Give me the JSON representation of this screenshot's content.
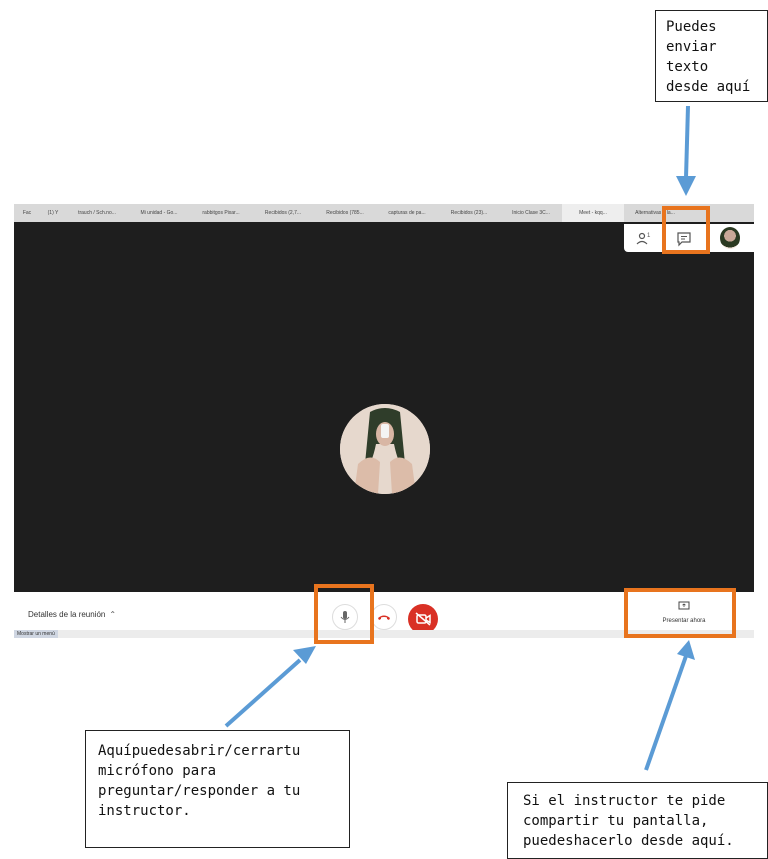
{
  "callouts": {
    "top": "Puedes\nenviar texto\ndesde aquí",
    "left": "Aquípuedesabrir/cerrartu\nmicrófono para\npreguntar/responder a tu\ninstructor.",
    "right": "Si el instructor te pide\ncompartir tu pantalla,\npuedeshacerlo desde aquí."
  },
  "tabs": [
    "Fac",
    "(1) Y",
    "trauch / Sch.no...",
    "Mi unidad - Go...",
    "rabbitgos Pixar...",
    "Recibidos (2,7...",
    "Recibidos (785...",
    "capturas de pa...",
    "Recibidos (23)...",
    "Inicio Clase 3C...",
    "Meet - kqq...",
    "Alternativas a la..."
  ],
  "controls": {
    "meeting_details": "Detalles de la reunión",
    "present_label": "Presentar ahora",
    "status_text": "Mostrar un menú"
  },
  "colors": {
    "highlight": "#e8741e",
    "arrow": "#5b9bd5",
    "hangup": "#d93025",
    "video_bg": "#1e1e1e"
  },
  "icons": {
    "people": "people-icon",
    "chat": "chat-icon",
    "mic": "microphone-icon",
    "hangup": "phone-hangup-icon",
    "camera": "camera-off-icon",
    "present": "present-screen-icon"
  }
}
